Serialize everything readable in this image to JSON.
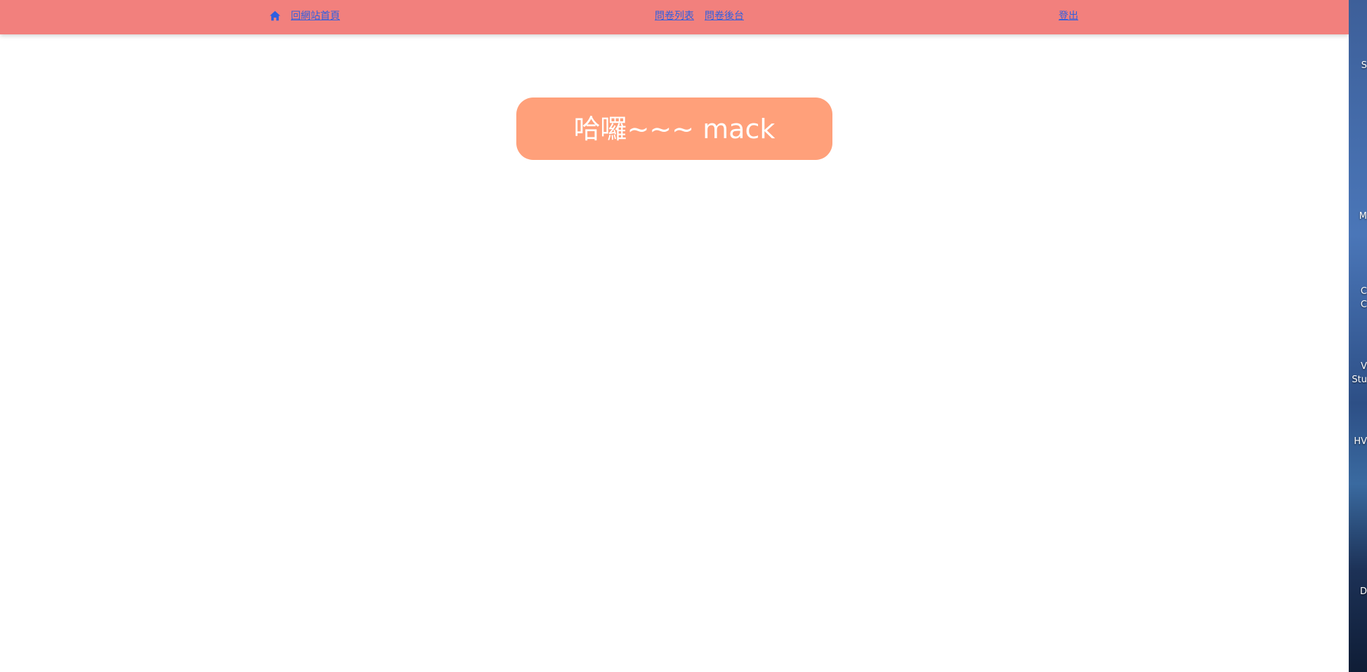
{
  "navbar": {
    "home_icon": "home-icon",
    "home_label": "回網站首頁",
    "survey_list_label": "問卷列表",
    "survey_admin_label": "問卷後台",
    "logout_label": "登出"
  },
  "main": {
    "greeting": "哈囉~~~ mack"
  },
  "desktop": {
    "labels": [
      "S",
      "M",
      "C",
      "C",
      "V",
      "Stu",
      "HV",
      "D"
    ]
  },
  "colors": {
    "navbar_bg": "#f2807d",
    "link": "#2f5fe0",
    "greeting_bg": "#ffa07a",
    "greeting_text": "#ffffff"
  }
}
